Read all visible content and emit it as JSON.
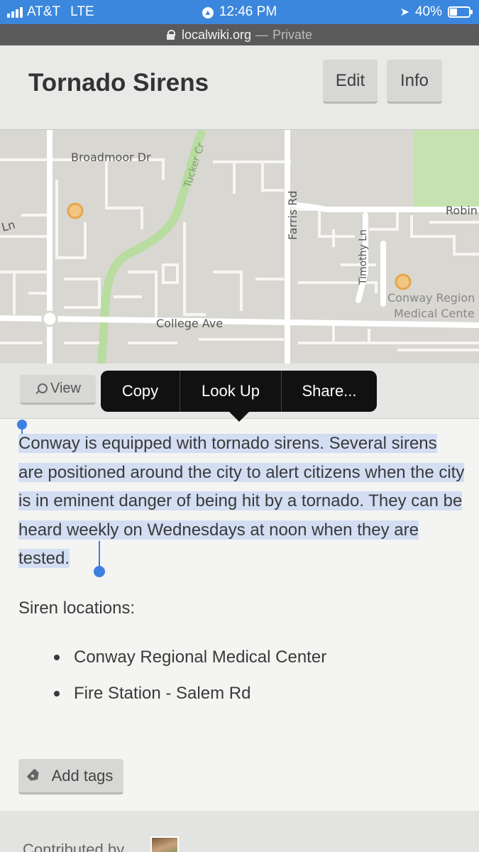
{
  "status_bar": {
    "carrier": "AT&T",
    "network": "LTE",
    "time": "12:46 PM",
    "battery": "40%",
    "battery_level": 0.4
  },
  "url_bar": {
    "host": "localwiki.org",
    "separator": "—",
    "mode": "Private"
  },
  "header": {
    "title": "Tornado Sirens",
    "edit_label": "Edit",
    "info_label": "Info"
  },
  "map": {
    "streets": [
      "Broadmoor Dr",
      "Tucker Cr",
      "Farris Rd",
      "Timothy Ln",
      "Robin",
      "Ln",
      "College Ave"
    ],
    "place_label_1": "Conway Region",
    "place_label_2": "Medical Cente",
    "marker_color": "#e9b25a"
  },
  "view_label": "View",
  "context_menu": {
    "copy": "Copy",
    "look_up": "Look Up",
    "share": "Share..."
  },
  "content": {
    "intro": "Conway is equipped with tornado sirens. Several sirens are positioned around the city to alert citizens when the city is in eminent danger of being hit by a tornado. They can be heard weekly on Wednesdays at noon when they are tested.",
    "locations_label": "Siren locations:",
    "locations": [
      "Conway Regional Medical Center",
      "Fire Station - Salem Rd"
    ]
  },
  "tags_label": "Add tags",
  "footer": {
    "contributed_by": "Contributed by"
  }
}
